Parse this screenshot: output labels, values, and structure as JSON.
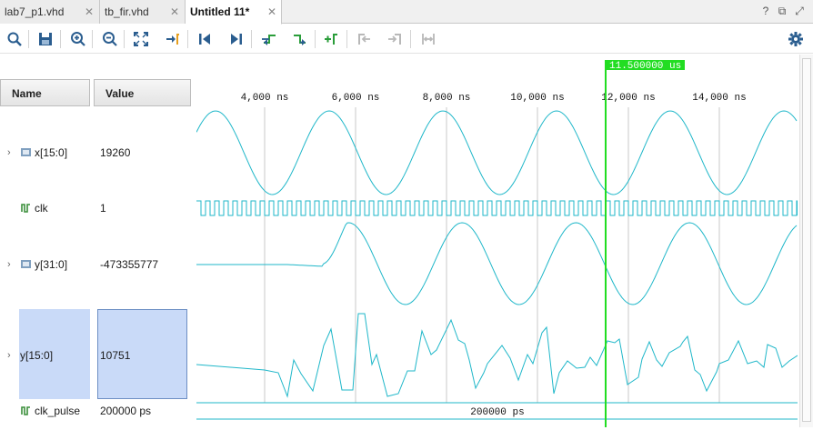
{
  "tabs": [
    {
      "label": "lab7_p1.vhd",
      "active": false
    },
    {
      "label": "tb_fir.vhd",
      "active": false
    },
    {
      "label": "Untitled 11*",
      "active": true
    }
  ],
  "window_controls": {
    "help": "?",
    "restore": "⧉",
    "maximize": "⤢"
  },
  "toolbar_icons": [
    "search-icon",
    "save-icon",
    "zoom-in-icon",
    "zoom-out-icon",
    "zoom-fit-icon",
    "go-to-cursor-icon",
    "go-to-time-0-icon",
    "go-to-last-time-icon",
    "previous-transition-icon",
    "next-transition-icon",
    "add-marker-icon",
    "previous-marker-icon",
    "next-marker-icon",
    "swap-cursors-icon",
    "settings-icon"
  ],
  "columns": {
    "name": "Name",
    "value": "Value"
  },
  "signals": [
    {
      "name": "x[15:0]",
      "value": "19260",
      "kind": "bus",
      "expandable": true
    },
    {
      "name": "clk",
      "value": "1",
      "kind": "bit",
      "expandable": false
    },
    {
      "name": "y[31:0]",
      "value": "-473355777",
      "kind": "bus",
      "expandable": true
    },
    {
      "name": "y[15:0]",
      "value": "10751",
      "kind": "bus",
      "expandable": true,
      "selected": true
    },
    {
      "name": "clk_pulse",
      "value": "200000 ps",
      "kind": "bit",
      "expandable": false
    }
  ],
  "timeline": {
    "ticks": [
      "4,000 ns",
      "6,000 ns",
      "8,000 ns",
      "10,000 ns",
      "12,000 ns",
      "14,000 ns"
    ],
    "tick_values_ns": [
      4000,
      6000,
      8000,
      10000,
      12000,
      14000
    ],
    "cursor_label": "11.500000 us",
    "cursor_ns": 11500,
    "clk_pulse_label": "200000 ps"
  },
  "colors": {
    "wave": "#1fb7c9",
    "cursor": "#22dd22",
    "cursor_label_bg": "#22dd22",
    "selection": "#c9daf8",
    "grid": "#c8c8c8"
  }
}
